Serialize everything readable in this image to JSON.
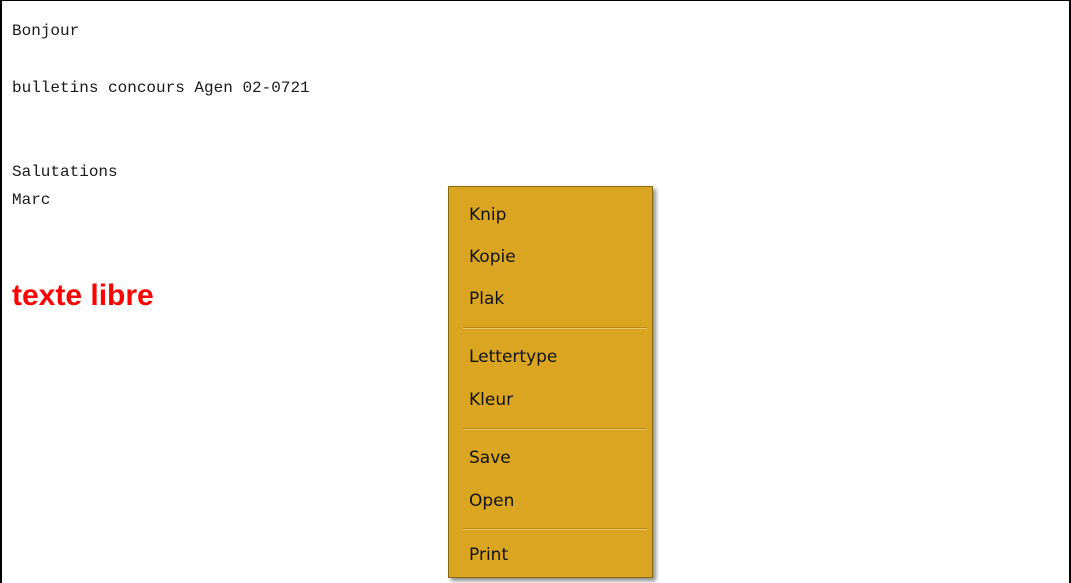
{
  "editor": {
    "lines": [
      "Bonjour",
      "bulletins concours Agen 02-0721",
      "Salutations",
      "Marc"
    ],
    "free_text": "texte libre",
    "free_text_color": "#ff0000"
  },
  "context_menu": {
    "background": "#daa520",
    "items": [
      "Knip",
      "Kopie",
      "Plak",
      "Lettertype",
      "Kleur",
      "Save",
      "Open",
      "Print"
    ]
  }
}
